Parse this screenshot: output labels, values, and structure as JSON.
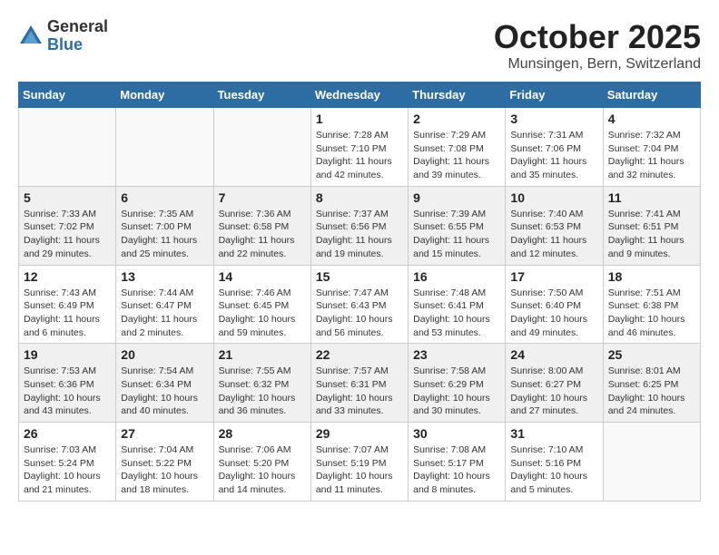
{
  "logo": {
    "general": "General",
    "blue": "Blue"
  },
  "title": "October 2025",
  "subtitle": "Munsingen, Bern, Switzerland",
  "headers": [
    "Sunday",
    "Monday",
    "Tuesday",
    "Wednesday",
    "Thursday",
    "Friday",
    "Saturday"
  ],
  "weeks": [
    [
      {
        "day": "",
        "info": ""
      },
      {
        "day": "",
        "info": ""
      },
      {
        "day": "",
        "info": ""
      },
      {
        "day": "1",
        "info": "Sunrise: 7:28 AM\nSunset: 7:10 PM\nDaylight: 11 hours\nand 42 minutes."
      },
      {
        "day": "2",
        "info": "Sunrise: 7:29 AM\nSunset: 7:08 PM\nDaylight: 11 hours\nand 39 minutes."
      },
      {
        "day": "3",
        "info": "Sunrise: 7:31 AM\nSunset: 7:06 PM\nDaylight: 11 hours\nand 35 minutes."
      },
      {
        "day": "4",
        "info": "Sunrise: 7:32 AM\nSunset: 7:04 PM\nDaylight: 11 hours\nand 32 minutes."
      }
    ],
    [
      {
        "day": "5",
        "info": "Sunrise: 7:33 AM\nSunset: 7:02 PM\nDaylight: 11 hours\nand 29 minutes."
      },
      {
        "day": "6",
        "info": "Sunrise: 7:35 AM\nSunset: 7:00 PM\nDaylight: 11 hours\nand 25 minutes."
      },
      {
        "day": "7",
        "info": "Sunrise: 7:36 AM\nSunset: 6:58 PM\nDaylight: 11 hours\nand 22 minutes."
      },
      {
        "day": "8",
        "info": "Sunrise: 7:37 AM\nSunset: 6:56 PM\nDaylight: 11 hours\nand 19 minutes."
      },
      {
        "day": "9",
        "info": "Sunrise: 7:39 AM\nSunset: 6:55 PM\nDaylight: 11 hours\nand 15 minutes."
      },
      {
        "day": "10",
        "info": "Sunrise: 7:40 AM\nSunset: 6:53 PM\nDaylight: 11 hours\nand 12 minutes."
      },
      {
        "day": "11",
        "info": "Sunrise: 7:41 AM\nSunset: 6:51 PM\nDaylight: 11 hours\nand 9 minutes."
      }
    ],
    [
      {
        "day": "12",
        "info": "Sunrise: 7:43 AM\nSunset: 6:49 PM\nDaylight: 11 hours\nand 6 minutes."
      },
      {
        "day": "13",
        "info": "Sunrise: 7:44 AM\nSunset: 6:47 PM\nDaylight: 11 hours\nand 2 minutes."
      },
      {
        "day": "14",
        "info": "Sunrise: 7:46 AM\nSunset: 6:45 PM\nDaylight: 10 hours\nand 59 minutes."
      },
      {
        "day": "15",
        "info": "Sunrise: 7:47 AM\nSunset: 6:43 PM\nDaylight: 10 hours\nand 56 minutes."
      },
      {
        "day": "16",
        "info": "Sunrise: 7:48 AM\nSunset: 6:41 PM\nDaylight: 10 hours\nand 53 minutes."
      },
      {
        "day": "17",
        "info": "Sunrise: 7:50 AM\nSunset: 6:40 PM\nDaylight: 10 hours\nand 49 minutes."
      },
      {
        "day": "18",
        "info": "Sunrise: 7:51 AM\nSunset: 6:38 PM\nDaylight: 10 hours\nand 46 minutes."
      }
    ],
    [
      {
        "day": "19",
        "info": "Sunrise: 7:53 AM\nSunset: 6:36 PM\nDaylight: 10 hours\nand 43 minutes."
      },
      {
        "day": "20",
        "info": "Sunrise: 7:54 AM\nSunset: 6:34 PM\nDaylight: 10 hours\nand 40 minutes."
      },
      {
        "day": "21",
        "info": "Sunrise: 7:55 AM\nSunset: 6:32 PM\nDaylight: 10 hours\nand 36 minutes."
      },
      {
        "day": "22",
        "info": "Sunrise: 7:57 AM\nSunset: 6:31 PM\nDaylight: 10 hours\nand 33 minutes."
      },
      {
        "day": "23",
        "info": "Sunrise: 7:58 AM\nSunset: 6:29 PM\nDaylight: 10 hours\nand 30 minutes."
      },
      {
        "day": "24",
        "info": "Sunrise: 8:00 AM\nSunset: 6:27 PM\nDaylight: 10 hours\nand 27 minutes."
      },
      {
        "day": "25",
        "info": "Sunrise: 8:01 AM\nSunset: 6:25 PM\nDaylight: 10 hours\nand 24 minutes."
      }
    ],
    [
      {
        "day": "26",
        "info": "Sunrise: 7:03 AM\nSunset: 5:24 PM\nDaylight: 10 hours\nand 21 minutes."
      },
      {
        "day": "27",
        "info": "Sunrise: 7:04 AM\nSunset: 5:22 PM\nDaylight: 10 hours\nand 18 minutes."
      },
      {
        "day": "28",
        "info": "Sunrise: 7:06 AM\nSunset: 5:20 PM\nDaylight: 10 hours\nand 14 minutes."
      },
      {
        "day": "29",
        "info": "Sunrise: 7:07 AM\nSunset: 5:19 PM\nDaylight: 10 hours\nand 11 minutes."
      },
      {
        "day": "30",
        "info": "Sunrise: 7:08 AM\nSunset: 5:17 PM\nDaylight: 10 hours\nand 8 minutes."
      },
      {
        "day": "31",
        "info": "Sunrise: 7:10 AM\nSunset: 5:16 PM\nDaylight: 10 hours\nand 5 minutes."
      },
      {
        "day": "",
        "info": ""
      }
    ]
  ]
}
